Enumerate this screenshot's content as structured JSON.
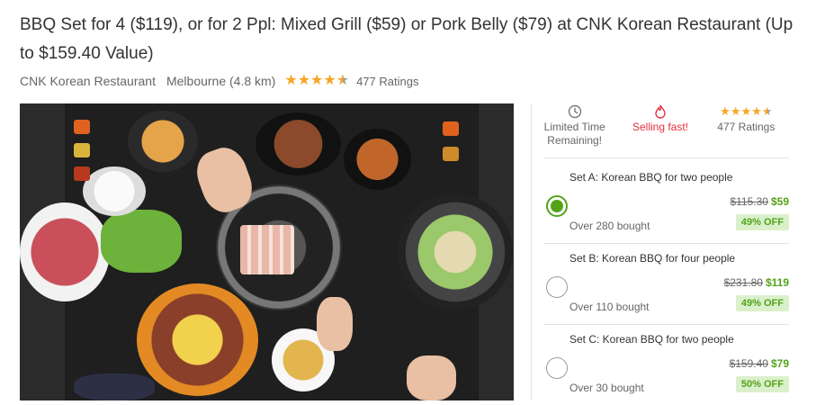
{
  "deal": {
    "title": "BBQ Set for 4 ($119), or for 2 Ppl: Mixed Grill ($59) or Pork Belly ($79) at CNK Korean Restaurant (Up to $159.40 Value)",
    "merchant": "CNK Korean Restaurant",
    "location": "Melbourne (4.8 km)",
    "rating": 4.5,
    "ratings_count": "477 Ratings"
  },
  "info_bar": {
    "limited_time": "Limited Time Remaining!",
    "selling_fast": "Selling fast!",
    "ratings_count": "477 Ratings",
    "accent": "#e2303e",
    "star_color": "#f5a623"
  },
  "options": [
    {
      "title": "Set A: Korean BBQ for two people",
      "old_price": "$115.30",
      "new_price": "$59",
      "bought": "Over 280 bought",
      "discount": "49% OFF",
      "selected": true
    },
    {
      "title": "Set B: Korean BBQ for four people",
      "old_price": "$231.80",
      "new_price": "$119",
      "bought": "Over 110 bought",
      "discount": "49% OFF",
      "selected": false
    },
    {
      "title": "Set C: Korean BBQ for two people",
      "old_price": "$159.40",
      "new_price": "$79",
      "bought": "Over 30 bought",
      "discount": "50% OFF",
      "selected": false
    }
  ],
  "colors": {
    "green": "#53a318",
    "badge_bg": "#daf0cb"
  }
}
